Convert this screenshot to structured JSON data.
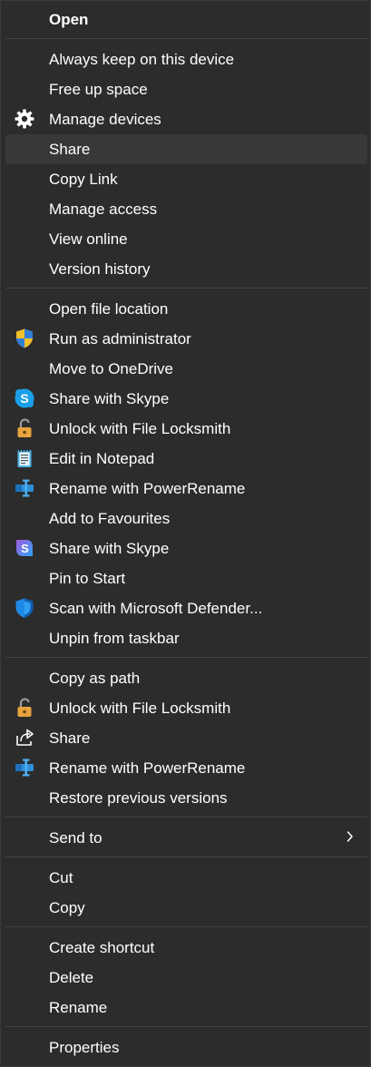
{
  "menu": {
    "open": "Open",
    "always_keep": "Always keep on this device",
    "free_up_space": "Free up space",
    "manage_devices": "Manage devices",
    "share_onedrive": "Share",
    "copy_link": "Copy Link",
    "manage_access": "Manage access",
    "view_online": "View online",
    "version_history": "Version history",
    "open_file_location": "Open file location",
    "run_as_admin": "Run as administrator",
    "move_to_onedrive": "Move to OneDrive",
    "share_with_skype_1": "Share with Skype",
    "unlock_locksmith_1": "Unlock with File Locksmith",
    "edit_in_notepad": "Edit in Notepad",
    "rename_powerrename_1": "Rename with PowerRename",
    "add_to_favourites": "Add to Favourites",
    "share_with_skype_2": "Share with Skype",
    "pin_to_start": "Pin to Start",
    "scan_defender": "Scan with Microsoft Defender...",
    "unpin_taskbar": "Unpin from taskbar",
    "copy_as_path": "Copy as path",
    "unlock_locksmith_2": "Unlock with File Locksmith",
    "share": "Share",
    "rename_powerrename_2": "Rename with PowerRename",
    "restore_previous": "Restore previous versions",
    "send_to": "Send to",
    "cut": "Cut",
    "copy": "Copy",
    "create_shortcut": "Create shortcut",
    "delete": "Delete",
    "rename": "Rename",
    "properties": "Properties"
  },
  "icons": {
    "manage_devices": "gear-icon",
    "run_as_admin": "uac-shield-icon",
    "share_with_skype_1": "skype-icon",
    "unlock_locksmith_1": "padlock-icon",
    "edit_in_notepad": "notepad-icon",
    "rename_powerrename_1": "powerrename-icon",
    "share_with_skype_2": "skype-preview-icon",
    "scan_defender": "defender-shield-icon",
    "unlock_locksmith_2": "padlock-icon",
    "share": "share-icon",
    "rename_powerrename_2": "powerrename-icon",
    "send_to": "chevron-right-icon"
  },
  "colors": {
    "menu_background": "#2c2c2c",
    "hover_background": "#383838",
    "separator": "#444444",
    "text": "#ffffff"
  },
  "state": {
    "highlighted_item": "Share"
  }
}
